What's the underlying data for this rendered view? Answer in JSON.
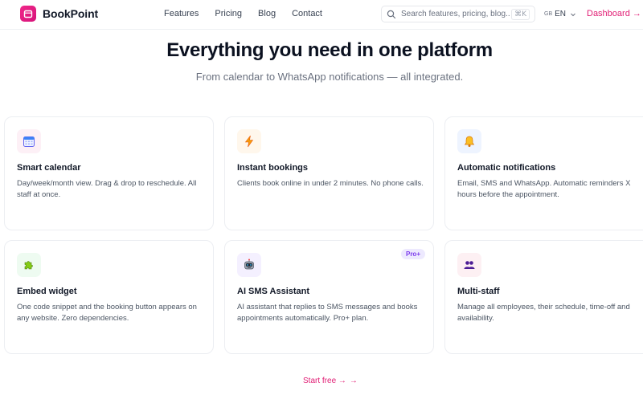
{
  "header": {
    "brand": "BookPoint",
    "nav": [
      "Features",
      "Pricing",
      "Blog",
      "Contact"
    ],
    "search": {
      "placeholder": "Search features, pricing, blog...",
      "shortcut": "⌘K"
    },
    "lang": {
      "flag": "GB",
      "code": "EN"
    },
    "dashboard": "Dashboard →"
  },
  "hero": {
    "title": "Everything you need in one platform",
    "subtitle": "From calendar to WhatsApp notifications — all integrated."
  },
  "features": [
    {
      "title": "Smart calendar",
      "desc": "Day/week/month view. Drag & drop to reschedule. All staff at once.",
      "icon": "calendar-icon",
      "bg": "#fdf0f6"
    },
    {
      "title": "Instant bookings",
      "desc": "Clients book online in under 2 minutes. No phone calls.",
      "icon": "lightning-icon",
      "bg": "#fff7ec"
    },
    {
      "title": "Automatic notifications",
      "desc": "Email, SMS and WhatsApp. Automatic reminders X hours before the appointment.",
      "icon": "bell-icon",
      "bg": "#eef4ff"
    },
    {
      "title": "Embed widget",
      "desc": "One code snippet and the booking button appears on any website. Zero dependencies.",
      "icon": "puzzle-icon",
      "bg": "#eefbf1"
    },
    {
      "title": "AI SMS Assistant",
      "desc": "AI assistant that replies to SMS messages and books appointments automatically. Pro+ plan.",
      "icon": "robot-icon",
      "bg": "#f4f0ff",
      "badge": "Pro+"
    },
    {
      "title": "Multi-staff",
      "desc": "Manage all employees, their schedule, time-off and availability.",
      "icon": "people-icon",
      "bg": "#fdf0f3"
    }
  ],
  "cta": {
    "label": "Start free →",
    "arrow": "→"
  },
  "colors": {
    "accent": "#e11d74",
    "text": "#111827",
    "muted": "#6b7280"
  }
}
